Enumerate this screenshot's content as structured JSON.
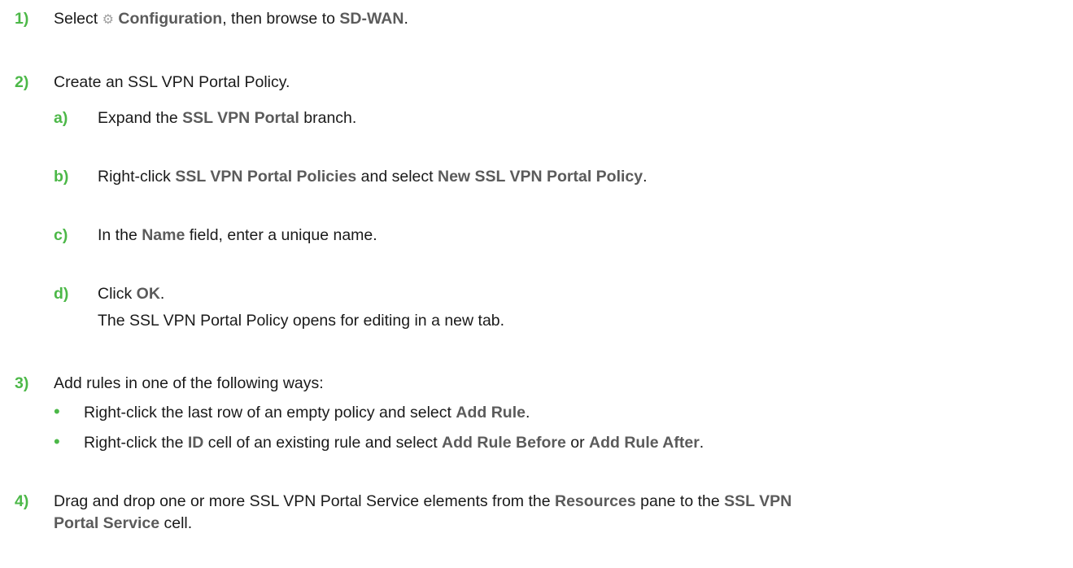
{
  "colors": {
    "step_number": "#4cb848",
    "ui_term": "#5b5b5b",
    "text": "#1a1a1a"
  },
  "steps": {
    "s1": {
      "num": "1)",
      "pre": "Select ",
      "icon": "gear-icon",
      "t1": "Configuration",
      "mid": ", then browse to ",
      "t2": "SD-WAN",
      "post": "."
    },
    "s2": {
      "num": "2)",
      "text": "Create an SSL VPN Portal Policy.",
      "a": {
        "num": "a)",
        "pre": "Expand the ",
        "t1": "SSL VPN Portal",
        "post": " branch."
      },
      "b": {
        "num": "b)",
        "pre": "Right-click ",
        "t1": "SSL VPN Portal Policies",
        "mid": " and select ",
        "t2": "New SSL VPN Portal Policy",
        "post": "."
      },
      "c": {
        "num": "c)",
        "pre": "In the ",
        "t1": "Name",
        "post": " field, enter a unique name."
      },
      "d": {
        "num": "d)",
        "pre": "Click ",
        "t1": "OK",
        "post": ".",
        "result": "The SSL VPN Portal Policy opens for editing in a new tab."
      }
    },
    "s3": {
      "num": "3)",
      "text": "Add rules in one of the following ways:",
      "bullet1": {
        "pre": "Right-click the last row of an empty policy and select ",
        "t1": "Add Rule",
        "post": "."
      },
      "bullet2": {
        "pre": "Right-click the ",
        "t1": "ID",
        "mid": " cell of an existing rule and select ",
        "t2": "Add Rule Before",
        "mid2": " or ",
        "t3": "Add Rule After",
        "post": "."
      }
    },
    "s4": {
      "num": "4)",
      "pre": "Drag and drop one or more SSL VPN Portal Service elements from the ",
      "t1": "Resources",
      "mid": " pane to the ",
      "t2": "SSL VPN",
      "t2b": "Portal Service",
      "post": " cell."
    }
  }
}
